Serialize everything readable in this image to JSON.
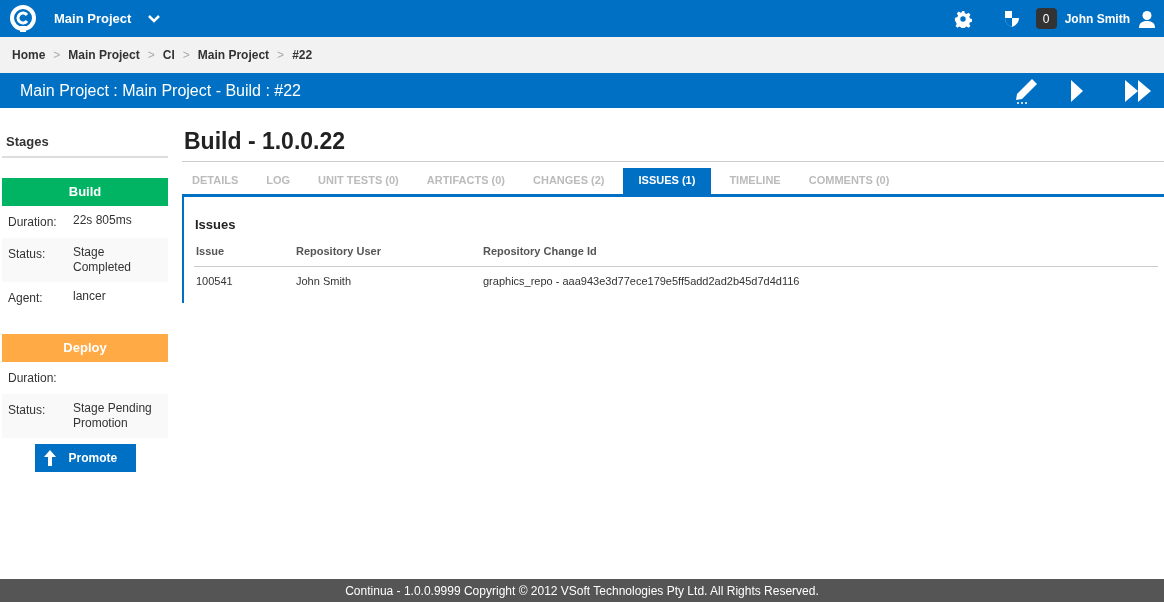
{
  "top_bar": {
    "project": "Main Project",
    "user": "John Smith",
    "notification_count": "0"
  },
  "breadcrumbs": [
    {
      "label": "Home",
      "separator": ">"
    },
    {
      "label": "Main Project",
      "separator": ">"
    },
    {
      "label": "CI",
      "separator": ">"
    },
    {
      "label": "Main Project",
      "separator": ">"
    },
    {
      "label": "#22"
    }
  ],
  "title_bar": {
    "title": "Main Project : Main Project - Build : #22"
  },
  "sidebar": {
    "title": "Stages",
    "stages": [
      {
        "name": "Build",
        "color": "#00b464",
        "fields": [
          {
            "label": "Duration:",
            "value": "22s 805ms"
          },
          {
            "label": "Status:",
            "value": "Stage Completed"
          },
          {
            "label": "Agent:",
            "value": "lancer"
          }
        ]
      },
      {
        "name": "Deploy",
        "color": "#ffaa44",
        "fields": [
          {
            "label": "Duration:"
          },
          {
            "label": "Status:",
            "value": "Stage Pending Promotion"
          }
        ],
        "action": "Promote"
      }
    ]
  },
  "main": {
    "heading": "Build - 1.0.0.22",
    "tabs": [
      {
        "label": "DETAILS",
        "selected": false
      },
      {
        "label": "LOG",
        "selected": false
      },
      {
        "label": "UNIT TESTS (0)",
        "selected": false
      },
      {
        "label": "ARTIFACTS (0)",
        "selected": false
      },
      {
        "label": "CHANGES (2)",
        "selected": false
      },
      {
        "label": "ISSUES (1)",
        "selected": true
      },
      {
        "label": "TIMELINE",
        "selected": false
      },
      {
        "label": "COMMENTS (0)",
        "selected": false
      }
    ],
    "issues": {
      "title": "Issues",
      "columns": [
        "Issue",
        "Repository User",
        "Repository Change Id"
      ],
      "rows": [
        [
          "100541",
          "John Smith",
          "graphics_repo - aaa943e3d77ece179e5ff5add2ad2b45d7d4d116"
        ]
      ]
    }
  },
  "footer": "Continua - 1.0.0.9999 Copyright © 2012 VSoft Technologies Pty Ltd. All Rights Reserved."
}
